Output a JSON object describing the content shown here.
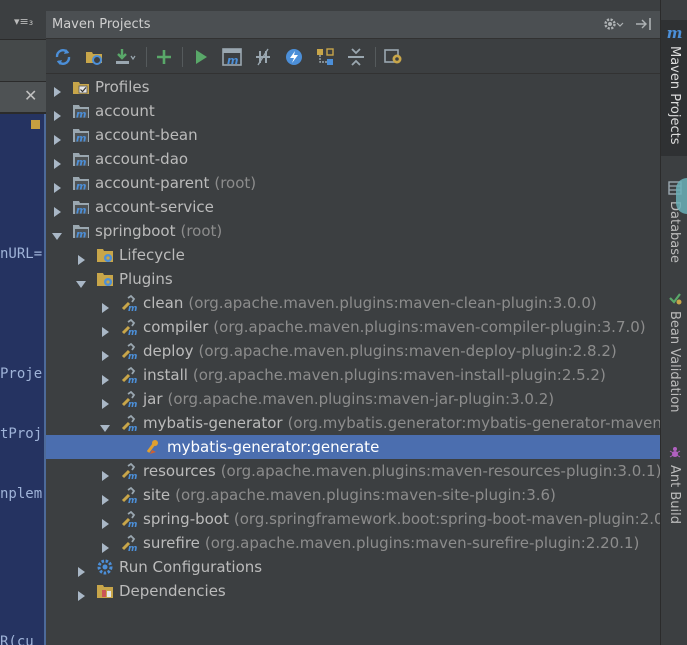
{
  "editor": {
    "menu_icon": "▾≡₃",
    "close_icon_glyph": "✕",
    "code_lines": [
      {
        "text": "nURL="
      },
      {
        "text": "Proje"
      },
      {
        "text": "tProj"
      },
      {
        "text": "nplem"
      },
      {
        "text": "R(cu"
      }
    ]
  },
  "panel": {
    "title": "Maven Projects",
    "settings_icon": "gear-icon",
    "hide_icon": "hide-panel-icon"
  },
  "toolbar": {
    "buttons": [
      {
        "name": "reimport-icon",
        "color": "#4c8fd8"
      },
      {
        "name": "generate-sources-icon",
        "color": "#c8a64a"
      },
      {
        "name": "download-icon",
        "color": "#59a869"
      },
      {
        "name": "add-icon",
        "color": "#59a869"
      },
      {
        "name": "run-icon",
        "color": "#59a869"
      },
      {
        "name": "execute-goal-icon",
        "color": "#9aa7b0"
      },
      {
        "name": "toggle-offline-icon",
        "color": "#9aa7b0"
      },
      {
        "name": "skip-tests-icon",
        "color": "#4c8fd8"
      },
      {
        "name": "show-dependencies-icon",
        "color": "#c8a64a"
      },
      {
        "name": "collapse-all-icon",
        "color": "#9aa7b0"
      },
      {
        "name": "maven-settings-icon",
        "color": "#c8a64a"
      }
    ]
  },
  "tree": {
    "items": [
      {
        "label": "Profiles",
        "sub": "",
        "icon": "profiles-icon",
        "level": 0,
        "expanded": false
      },
      {
        "label": "account",
        "sub": "",
        "icon": "maven-module-icon",
        "level": 0,
        "expanded": false
      },
      {
        "label": "account-bean",
        "sub": "",
        "icon": "maven-module-icon",
        "level": 0,
        "expanded": false
      },
      {
        "label": "account-dao",
        "sub": "",
        "icon": "maven-module-icon",
        "level": 0,
        "expanded": false
      },
      {
        "label": "account-parent",
        "sub": "(root)",
        "icon": "maven-module-icon",
        "level": 0,
        "expanded": false
      },
      {
        "label": "account-service",
        "sub": "",
        "icon": "maven-module-icon",
        "level": 0,
        "expanded": false
      },
      {
        "label": "springboot",
        "sub": "(root)",
        "icon": "maven-module-icon",
        "level": 0,
        "expanded": true
      },
      {
        "label": "Lifecycle",
        "sub": "",
        "icon": "lifecycle-folder-icon",
        "level": 1,
        "expanded": false
      },
      {
        "label": "Plugins",
        "sub": "",
        "icon": "plugins-folder-icon",
        "level": 1,
        "expanded": true
      },
      {
        "label": "clean",
        "sub": "(org.apache.maven.plugins:maven-clean-plugin:3.0.0)",
        "icon": "plugin-icon",
        "level": 2,
        "expanded": false
      },
      {
        "label": "compiler",
        "sub": "(org.apache.maven.plugins:maven-compiler-plugin:3.7.0)",
        "icon": "plugin-icon",
        "level": 2,
        "expanded": false
      },
      {
        "label": "deploy",
        "sub": "(org.apache.maven.plugins:maven-deploy-plugin:2.8.2)",
        "icon": "plugin-icon",
        "level": 2,
        "expanded": false
      },
      {
        "label": "install",
        "sub": "(org.apache.maven.plugins:maven-install-plugin:2.5.2)",
        "icon": "plugin-icon",
        "level": 2,
        "expanded": false
      },
      {
        "label": "jar",
        "sub": "(org.apache.maven.plugins:maven-jar-plugin:3.0.2)",
        "icon": "plugin-icon",
        "level": 2,
        "expanded": false
      },
      {
        "label": "mybatis-generator",
        "sub": "(org.mybatis.generator:mybatis-generator-maven-p",
        "icon": "plugin-icon",
        "level": 2,
        "expanded": true
      },
      {
        "label": "mybatis-generator:generate",
        "sub": "",
        "icon": "goal-icon",
        "level": 3,
        "expanded": null,
        "selected": true
      },
      {
        "label": "resources",
        "sub": "(org.apache.maven.plugins:maven-resources-plugin:3.0.1)",
        "icon": "plugin-icon",
        "level": 2,
        "expanded": false
      },
      {
        "label": "site",
        "sub": "(org.apache.maven.plugins:maven-site-plugin:3.6)",
        "icon": "plugin-icon",
        "level": 2,
        "expanded": false
      },
      {
        "label": "spring-boot",
        "sub": "(org.springframework.boot:spring-boot-maven-plugin:2.0",
        "icon": "plugin-icon",
        "level": 2,
        "expanded": false
      },
      {
        "label": "surefire",
        "sub": "(org.apache.maven.plugins:maven-surefire-plugin:2.20.1)",
        "icon": "plugin-icon",
        "level": 2,
        "expanded": false
      },
      {
        "label": "Run Configurations",
        "sub": "",
        "icon": "run-configurations-icon",
        "level": 1,
        "expanded": false
      },
      {
        "label": "Dependencies",
        "sub": "",
        "icon": "dependencies-folder-icon",
        "level": 1,
        "expanded": false
      }
    ]
  },
  "right_strip": {
    "tabs": [
      {
        "label": "Maven Projects",
        "icon": "maven-icon",
        "active": true
      },
      {
        "label": "Database",
        "icon": "database-icon",
        "active": false
      },
      {
        "label": "Bean Validation",
        "icon": "bean-validation-icon",
        "active": false
      },
      {
        "label": "Ant Build",
        "icon": "ant-icon",
        "active": false
      }
    ]
  },
  "colors": {
    "panel_bg": "#3c3f41",
    "selection": "#4b6eaf",
    "text": "#bbbbbb",
    "subtext": "#8c8c8c",
    "editor_bg": "#253361"
  }
}
